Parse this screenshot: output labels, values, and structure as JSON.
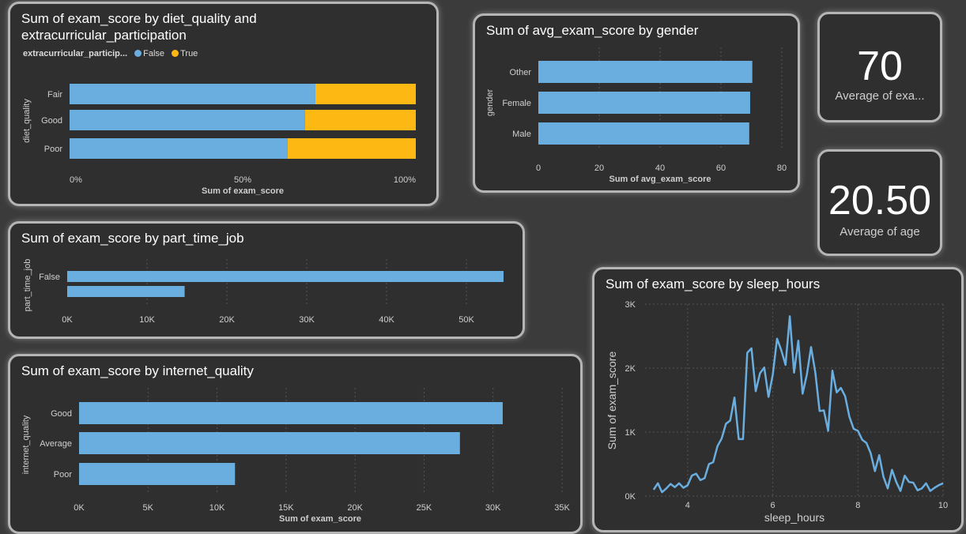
{
  "colors": {
    "primary": "#6aaee0",
    "secondary": "#fdb813",
    "text": "#ffffff",
    "axis": "#cfcfcf",
    "grid": "#555555"
  },
  "kpis": [
    {
      "value": "70",
      "label": "Average of exa..."
    },
    {
      "value": "20.50",
      "label": "Average of age"
    }
  ],
  "chart_data": [
    {
      "id": "diet",
      "type": "bar",
      "stacked": "100%",
      "title": "Sum of exam_score by diet_quality and extracurricular_participation",
      "title_lines": [
        "Sum of exam_score by diet_quality and",
        "extracurricular_participation"
      ],
      "xlabel": "Sum of exam_score",
      "ylabel": "diet_quality",
      "legend_title": "extracurricular_particip...",
      "categories": [
        "Fair",
        "Good",
        "Poor"
      ],
      "series": [
        {
          "name": "False",
          "values": [
            71,
            68,
            63
          ]
        },
        {
          "name": "True",
          "values": [
            29,
            32,
            37
          ]
        }
      ],
      "xlim": [
        0,
        100
      ],
      "x_ticks": [
        "0%",
        "50%",
        "100%"
      ],
      "legend_position": "top-left"
    },
    {
      "id": "gender",
      "type": "bar",
      "title": "Sum of avg_exam_score by gender",
      "xlabel": "Sum of avg_exam_score",
      "ylabel": "gender",
      "categories": [
        "Other",
        "Female",
        "Male"
      ],
      "values": [
        70.3,
        69.6,
        69.3
      ],
      "xlim": [
        0,
        80
      ],
      "x_ticks": [
        "0",
        "20",
        "40",
        "60",
        "80"
      ]
    },
    {
      "id": "parttime",
      "type": "bar",
      "title": "Sum of exam_score by part_time_job",
      "xlabel": "",
      "ylabel": "part_time_job",
      "categories": [
        "False",
        ""
      ],
      "values": [
        55000,
        14800
      ],
      "xlim": [
        0,
        55000
      ],
      "x_ticks": [
        "0K",
        "10K",
        "20K",
        "30K",
        "40K",
        "50K"
      ]
    },
    {
      "id": "internet",
      "type": "bar",
      "title": "Sum of exam_score by internet_quality",
      "xlabel": "Sum of exam_score",
      "ylabel": "internet_quality",
      "categories": [
        "Good",
        "Average",
        "Poor"
      ],
      "values": [
        30700,
        27600,
        11300
      ],
      "xlim": [
        0,
        35000
      ],
      "x_ticks": [
        "0K",
        "5K",
        "10K",
        "15K",
        "20K",
        "25K",
        "30K",
        "35K"
      ]
    },
    {
      "id": "sleep",
      "type": "line",
      "title": "Sum of exam_score by sleep_hours",
      "xlabel": "sleep_hours",
      "ylabel": "Sum of exam_score",
      "xlim": [
        3,
        10
      ],
      "ylim": [
        0,
        3000
      ],
      "x_ticks": [
        "4",
        "6",
        "8",
        "10"
      ],
      "y_ticks": [
        "0K",
        "1K",
        "2K",
        "3K"
      ],
      "x": [
        3.2,
        3.3,
        3.4,
        3.5,
        3.6,
        3.7,
        3.8,
        3.9,
        4.0,
        4.1,
        4.2,
        4.3,
        4.4,
        4.5,
        4.6,
        4.7,
        4.8,
        4.9,
        5.0,
        5.1,
        5.2,
        5.3,
        5.4,
        5.5,
        5.6,
        5.7,
        5.8,
        5.9,
        6.0,
        6.1,
        6.2,
        6.3,
        6.4,
        6.5,
        6.6,
        6.7,
        6.8,
        6.9,
        7.0,
        7.1,
        7.2,
        7.3,
        7.4,
        7.5,
        7.6,
        7.7,
        7.8,
        7.9,
        8.0,
        8.1,
        8.2,
        8.3,
        8.4,
        8.5,
        8.6,
        8.7,
        8.8,
        8.9,
        9.0,
        9.1,
        9.2,
        9.3,
        9.4,
        9.5,
        9.6,
        9.7,
        9.8,
        9.9,
        10.0
      ],
      "y": [
        100,
        200,
        60,
        120,
        190,
        140,
        200,
        130,
        170,
        320,
        350,
        250,
        280,
        500,
        530,
        780,
        900,
        1130,
        1180,
        1540,
        890,
        890,
        2240,
        2310,
        1640,
        1920,
        2010,
        1550,
        1900,
        2460,
        2280,
        2050,
        2810,
        1930,
        2430,
        1600,
        1900,
        2330,
        1930,
        1330,
        1340,
        1020,
        1960,
        1620,
        1690,
        1560,
        1240,
        1050,
        1020,
        880,
        830,
        670,
        390,
        640,
        300,
        120,
        410,
        220,
        80,
        320,
        220,
        210,
        90,
        120,
        200,
        80,
        130,
        170,
        200
      ],
      "grid": true
    }
  ]
}
